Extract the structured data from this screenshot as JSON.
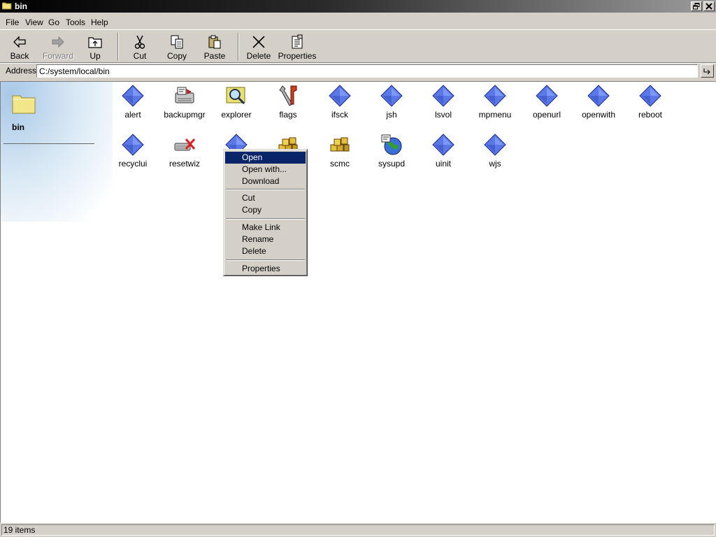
{
  "window": {
    "title": "bin"
  },
  "menu": [
    "File",
    "View",
    "Go",
    "Tools",
    "Help"
  ],
  "toolbar": {
    "back": "Back",
    "forward": "Forward",
    "up": "Up",
    "cut": "Cut",
    "copy": "Copy",
    "paste": "Paste",
    "delete": "Delete",
    "properties": "Properties"
  },
  "address": {
    "label": "Address",
    "value": "C:/system/local/bin"
  },
  "panel": {
    "title": "bin"
  },
  "files": [
    {
      "name": "alert",
      "icon": "diamond-icon"
    },
    {
      "name": "backupmgr",
      "icon": "backup-manager-icon"
    },
    {
      "name": "explorer",
      "icon": "explorer-magnifier-icon"
    },
    {
      "name": "flags",
      "icon": "tools-icon"
    },
    {
      "name": "ifsck",
      "icon": "diamond-icon"
    },
    {
      "name": "jsh",
      "icon": "diamond-icon"
    },
    {
      "name": "lsvol",
      "icon": "diamond-icon"
    },
    {
      "name": "mpmenu",
      "icon": "diamond-icon"
    },
    {
      "name": "openurl",
      "icon": "diamond-icon"
    },
    {
      "name": "openwith",
      "icon": "diamond-icon"
    },
    {
      "name": "reboot",
      "icon": "diamond-icon"
    },
    {
      "name": "recyclui",
      "icon": "diamond-icon"
    },
    {
      "name": "resetwiz",
      "icon": "reset-wizard-icon"
    },
    {
      "name": "",
      "icon": "diamond-icon"
    },
    {
      "name": "",
      "icon": "cubes-icon"
    },
    {
      "name": "scmc",
      "icon": "cubes-icon"
    },
    {
      "name": "sysupd",
      "icon": "globe-update-icon"
    },
    {
      "name": "uinit",
      "icon": "diamond-icon"
    },
    {
      "name": "wjs",
      "icon": "diamond-icon"
    }
  ],
  "context_menu": {
    "open": "Open",
    "open_with": "Open with...",
    "download": "Download",
    "cut": "Cut",
    "copy": "Copy",
    "make_link": "Make Link",
    "rename": "Rename",
    "delete": "Delete",
    "properties": "Properties"
  },
  "status": {
    "text": "19 items"
  },
  "colors": {
    "selection": "#0a246a",
    "diamond": "#5a78e8",
    "face": "#d4d0c8"
  }
}
